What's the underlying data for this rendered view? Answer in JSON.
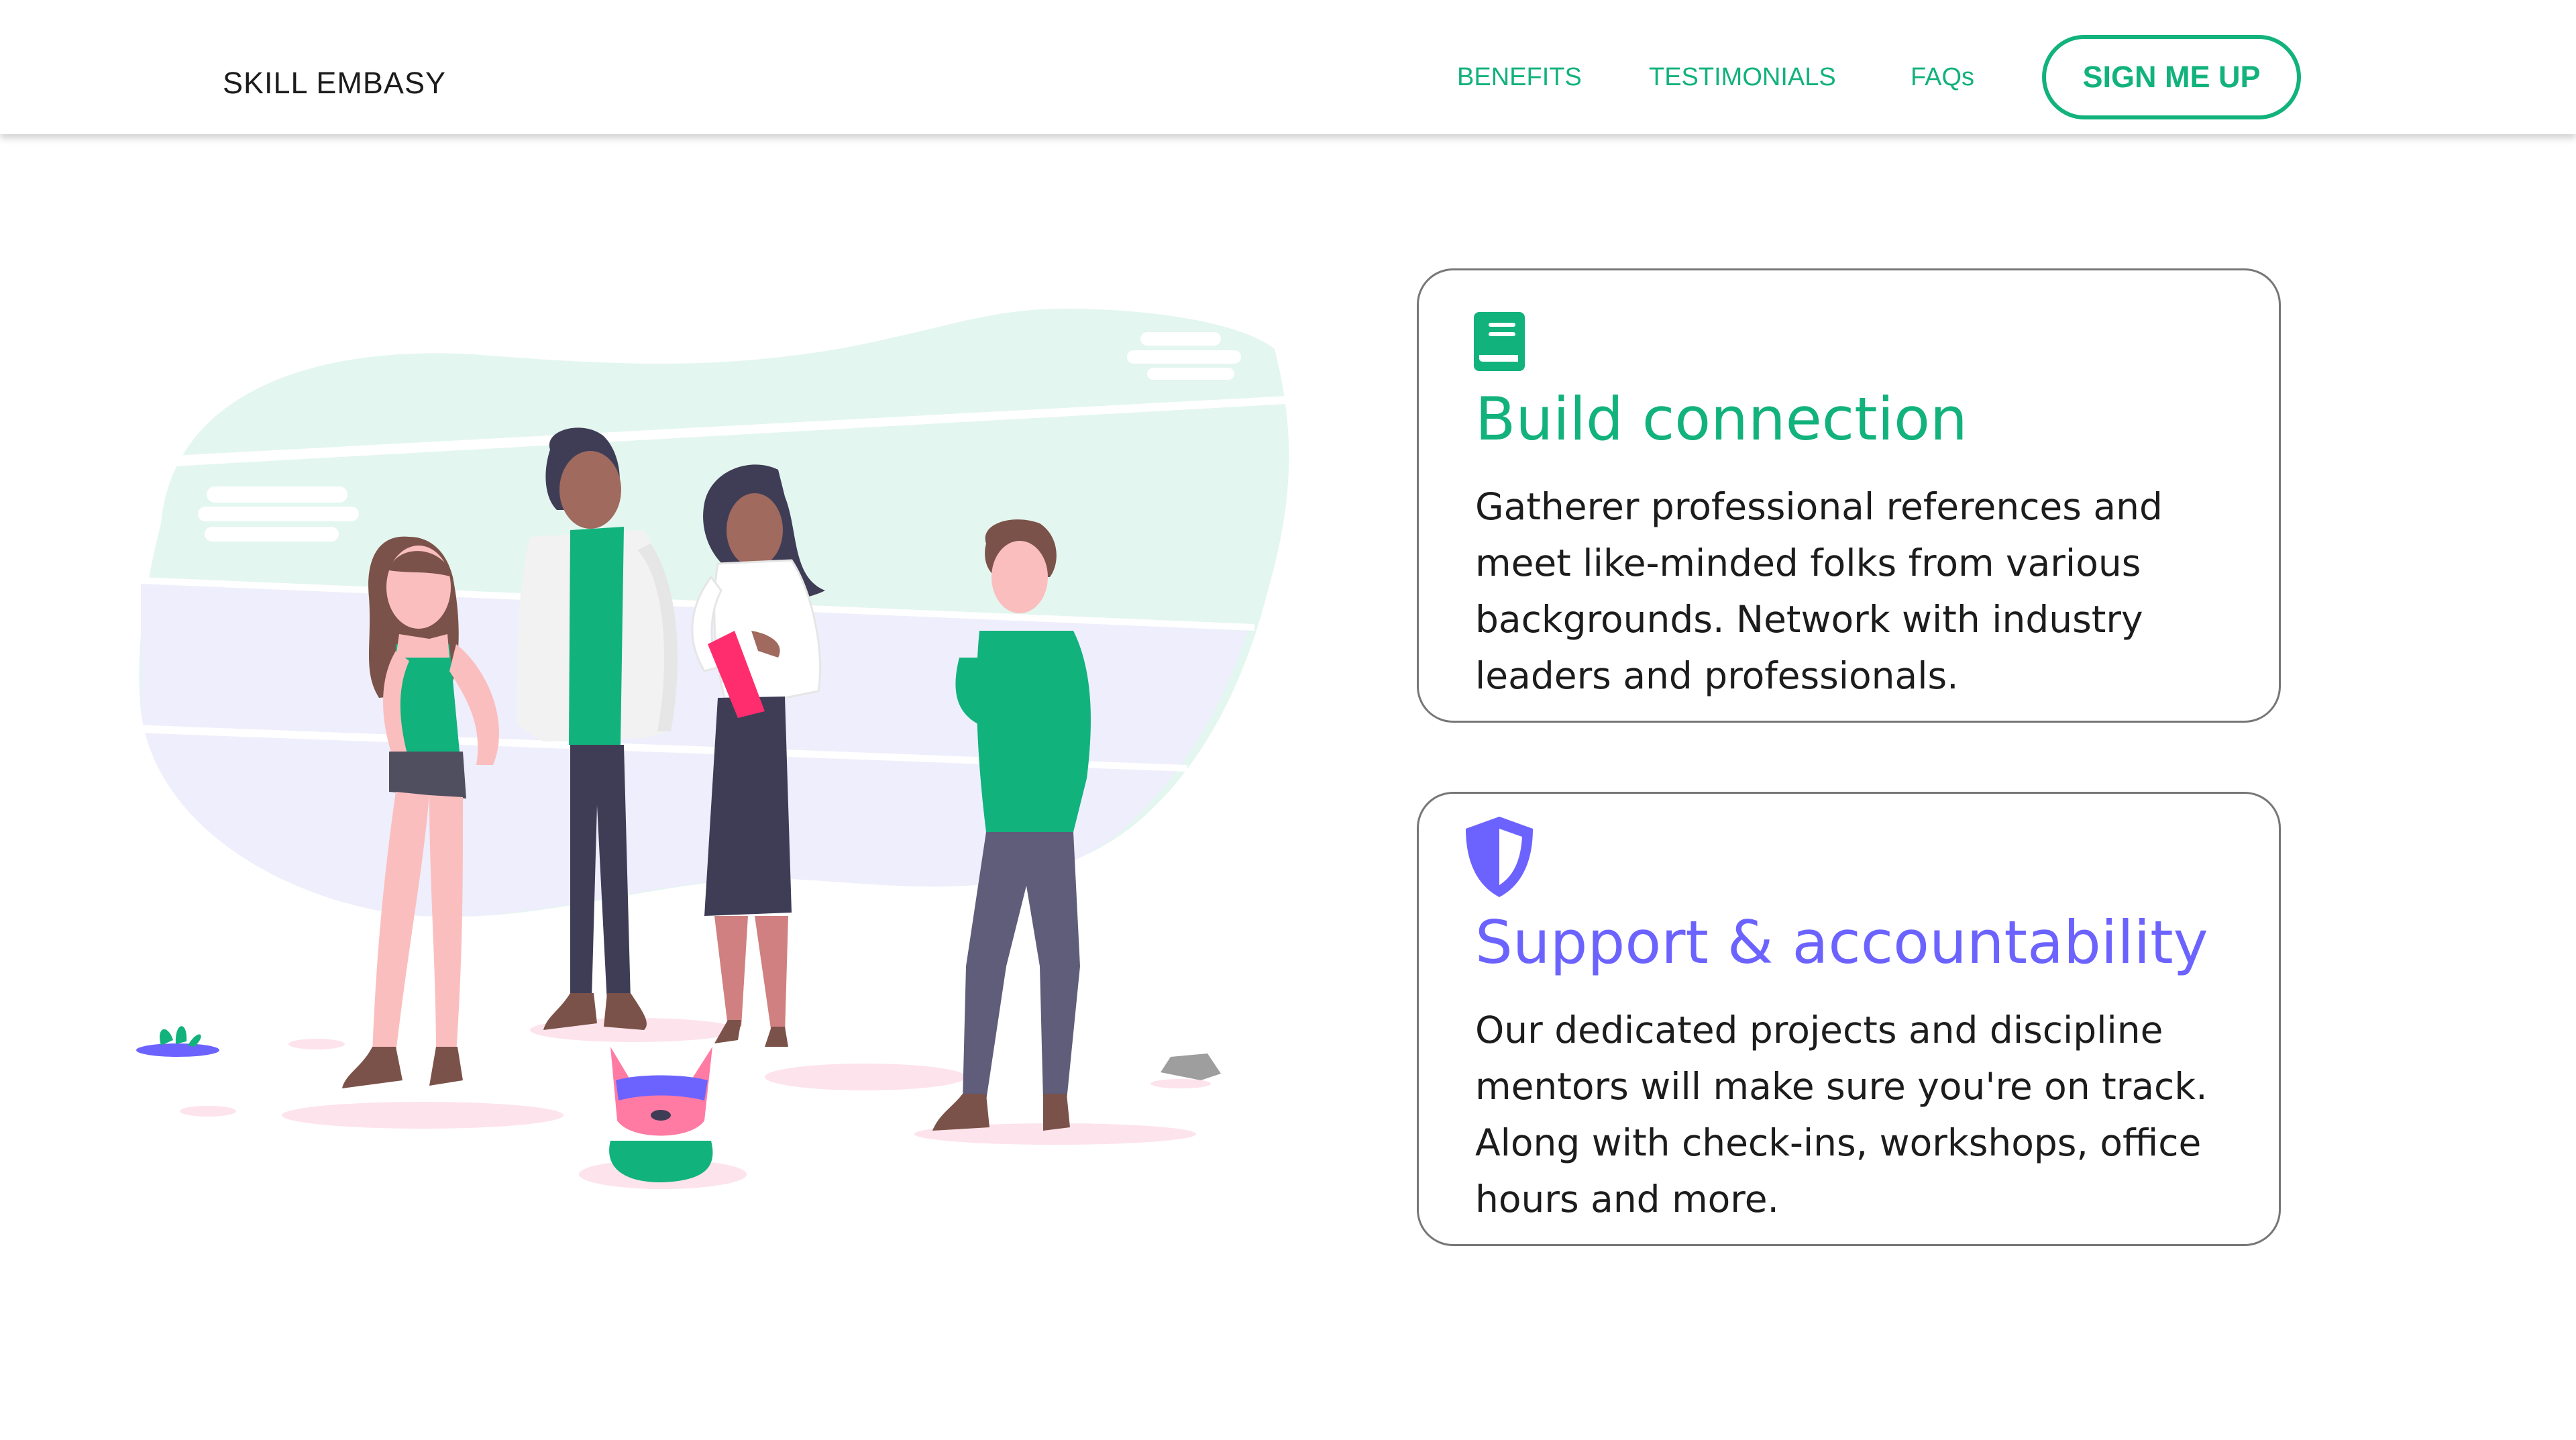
{
  "header": {
    "brand": "SKILL EMBASY",
    "nav": [
      {
        "label": "BENEFITS"
      },
      {
        "label": "TESTIMONIALS"
      },
      {
        "label": "FAQs"
      }
    ],
    "cta_label": "SIGN ME UP"
  },
  "features": [
    {
      "icon": "book-icon",
      "title": "Build connection",
      "text": "Gatherer professional references and meet like-minded folks from various backgrounds. Network with industry leaders and professionals.",
      "color": "#12b27c"
    },
    {
      "icon": "shield-icon",
      "title": "Support & accountability",
      "text": "Our dedicated projects and discipline mentors will make sure you're on track. Along with check-ins, workshops, office hours and more.",
      "color": "#6c63ff"
    }
  ],
  "colors": {
    "accent_green": "#12b27c",
    "accent_purple": "#6c63ff"
  }
}
